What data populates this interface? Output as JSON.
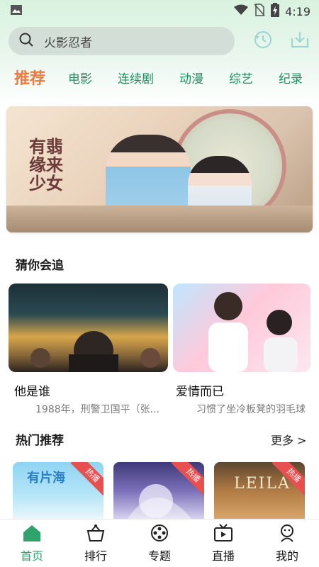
{
  "status_bar": {
    "time": "4:19",
    "icons": [
      "image-icon",
      "wifi-icon",
      "no-sim-icon",
      "battery-charging-icon"
    ]
  },
  "search": {
    "value": "火影忍者",
    "icons": [
      "search-icon",
      "history-icon",
      "download-icon"
    ]
  },
  "categories": [
    "推荐",
    "电影",
    "连续剧",
    "动漫",
    "综艺",
    "纪录"
  ],
  "banner": {
    "title_art": "有翡缘来少女"
  },
  "guess": {
    "title": "猜你会追",
    "items": [
      {
        "title": "他是谁",
        "subtitle": "1988年，刑警卫国平（张..."
      },
      {
        "title": "爱情而已",
        "subtitle": "习惯了坐冷板凳的羽毛球"
      }
    ]
  },
  "hot": {
    "title": "热门推荐",
    "more_label": "更多 >",
    "badge": "热播",
    "items": [
      {
        "poster_text": "有片海"
      },
      {
        "poster_text": ""
      },
      {
        "poster_text": "LEILA"
      }
    ]
  },
  "bottom_nav": [
    {
      "label": "首页",
      "icon": "home-icon",
      "active": true
    },
    {
      "label": "排行",
      "icon": "ranking-icon",
      "active": false
    },
    {
      "label": "专题",
      "icon": "topic-reel-icon",
      "active": false
    },
    {
      "label": "直播",
      "icon": "live-tv-icon",
      "active": false
    },
    {
      "label": "我的",
      "icon": "profile-icon",
      "active": false
    }
  ],
  "colors": {
    "accent_green": "#2fa36b",
    "tab_active_orange": "#ef7a3e",
    "badge_red": "#e8504f"
  }
}
